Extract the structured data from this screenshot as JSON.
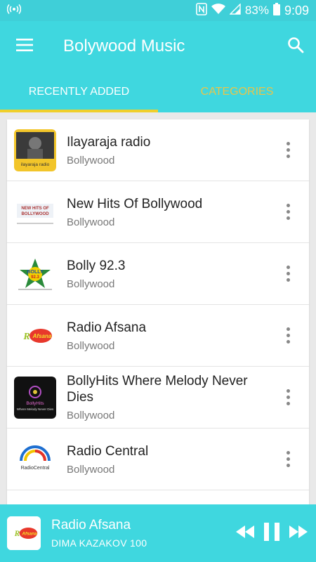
{
  "status_bar": {
    "battery": "83%",
    "time": "9:09"
  },
  "app_bar": {
    "title": "Bolywood Music"
  },
  "tabs": [
    {
      "label": "RECENTLY ADDED",
      "active": true
    },
    {
      "label": "CATEGORIES",
      "active": false
    }
  ],
  "stations": [
    {
      "title": "Ilayaraja radio",
      "category": "Bollywood",
      "logo_text": "ilayaraja radio"
    },
    {
      "title": "New Hits Of Bollywood",
      "category": "Bollywood",
      "logo_text": "NEW HITS OF BOLLYWOOD"
    },
    {
      "title": "Bolly 92.3",
      "category": "Bollywood",
      "logo_text": "BOLLY 92.3"
    },
    {
      "title": "Radio Afsana",
      "category": "Bollywood",
      "logo_text": "RadioAfsana"
    },
    {
      "title": "BollyHits Where Melody Never Dies",
      "category": "Bollywood",
      "logo_text": "BollyHits Where Melody Never Dies"
    },
    {
      "title": "Radio Central",
      "category": "Bollywood",
      "logo_text": "RadioCentral"
    }
  ],
  "player": {
    "station": "Radio Afsana",
    "track": "DIMA KAZAKOV 100",
    "logo_text": "RadioAfsana"
  },
  "colors": {
    "primary": "#3fd7df",
    "tab_indicator": "#f0cf2a",
    "inactive_tab": "#e8c54a"
  }
}
